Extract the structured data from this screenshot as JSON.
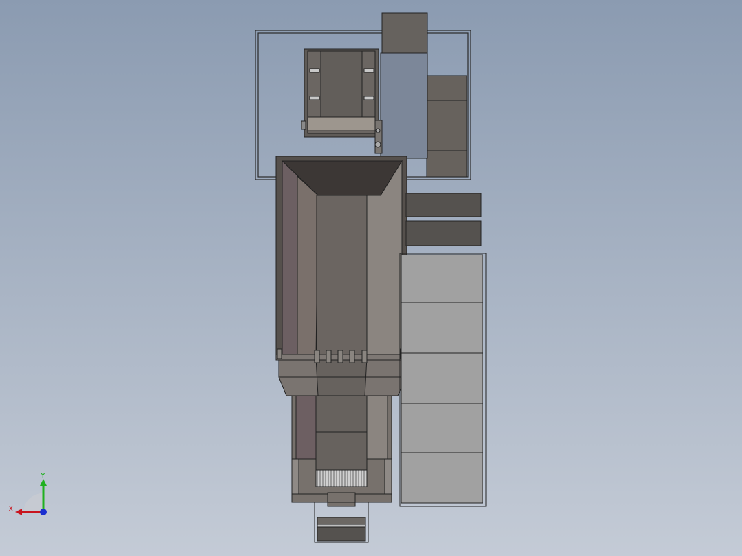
{
  "viewport": {
    "background_top": "#8b9bb1",
    "background_bottom": "#c4cbd6"
  },
  "triad": {
    "x_label": "X",
    "y_label": "Y",
    "x_color": "#c8141e",
    "y_color": "#20b020",
    "z_color": "#1a2fd0"
  },
  "model": {
    "line_color": "#202020",
    "hopper_dark": "#3c3735",
    "hopper_mid": "#6b6561",
    "hopper_light": "#8b8580",
    "panel_blue": "#7c8799",
    "panel_gray": "#a1a1a1",
    "conveyor_dark": "#55524f"
  }
}
